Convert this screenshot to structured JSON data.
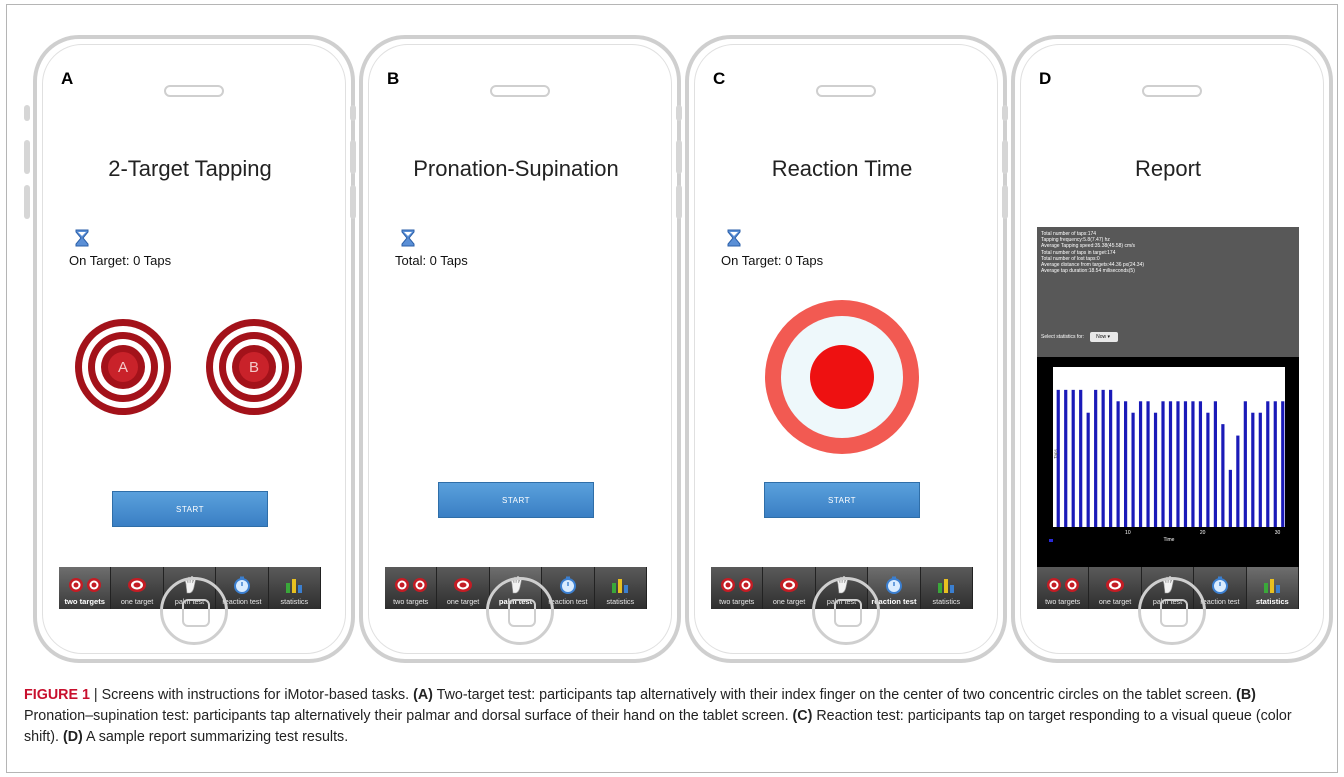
{
  "panels": [
    {
      "letter": "A",
      "title": "2-Target Tapping",
      "status": "On Target: 0 Taps",
      "start": "START",
      "active_tab": 0
    },
    {
      "letter": "B",
      "title": "Pronation-Supination",
      "status": "Total: 0 Taps",
      "start": "START",
      "active_tab": 2
    },
    {
      "letter": "C",
      "title": "Reaction Time",
      "status": "On Target: 0 Taps",
      "start": "START",
      "active_tab": 3
    },
    {
      "letter": "D",
      "title": "Report",
      "active_tab": 4
    }
  ],
  "targets": {
    "a_label": "A",
    "b_label": "B"
  },
  "tabs": [
    "two targets",
    "one target",
    "palm test",
    "reaction test",
    "statistics"
  ],
  "report": {
    "stats": [
      "Total number of taps:174",
      "Tapping frequency:5.8(7.47) hz",
      "Average Tapping speed:35.38(45.58) cm/s",
      "Total number of taps in target:174",
      "Total number of lost taps:0",
      "Average distance from targets:44.36 px(24.34)",
      "Average tap duration:18.54 miliseconds(5)"
    ],
    "select_label": "Select statistics for:",
    "select_value": "Now",
    "chart_data": {
      "type": "bar",
      "xlabel": "Time",
      "ylabel": "Taps",
      "x_ticks": [
        10,
        20,
        30
      ],
      "xlim": [
        0,
        31
      ],
      "ylim": [
        0,
        7
      ],
      "values": [
        6,
        6,
        6,
        6,
        5,
        6,
        6,
        6,
        5.5,
        5.5,
        5,
        5.5,
        5.5,
        5,
        5.5,
        5.5,
        5.5,
        5.5,
        5.5,
        5.5,
        5,
        5.5,
        4.5,
        2.5,
        4,
        5.5,
        5,
        5,
        5.5,
        5.5,
        5.5
      ],
      "bar_color": "#1a1ab8"
    }
  },
  "colors": {
    "target_red": "#a3121a",
    "reaction_outer": "#f25a52",
    "reaction_inner": "#ee1111",
    "reaction_ring": "#eef8fb"
  },
  "caption": {
    "label": "FIGURE 1",
    "text": " | Screens with instructions for iMotor-based tasks. ",
    "a_ref": "(A)",
    "a_text": " Two-target test: participants tap alternatively with their index finger on the center of two concentric circles on the tablet screen. ",
    "b_ref": "(B)",
    "b_text": " Pronation–supination test: participants tap alternatively their palmar and dorsal surface of their hand on the tablet screen. ",
    "c_ref": "(C)",
    "c_text": " Reaction test: participants tap on target responding to a visual queue (color shift). ",
    "d_ref": "(D)",
    "d_text": " A sample report summarizing test results."
  }
}
